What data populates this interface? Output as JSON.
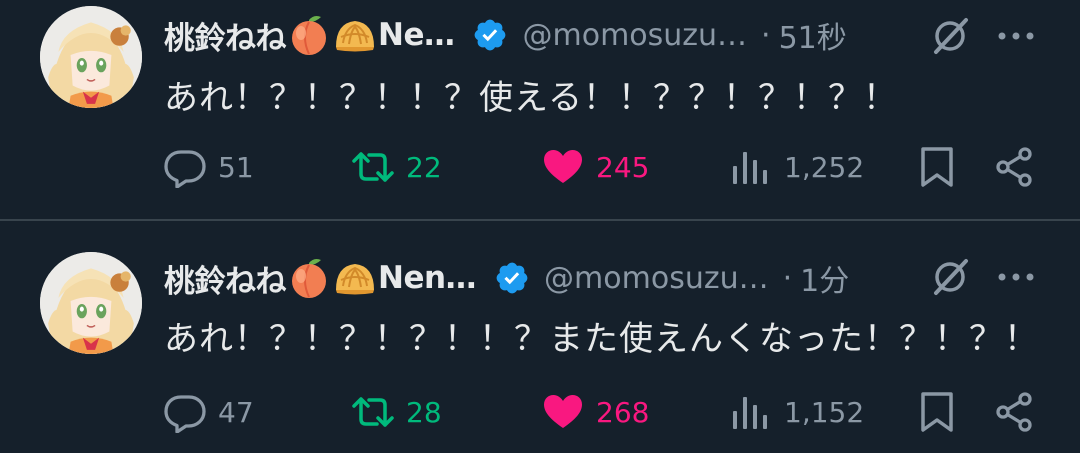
{
  "colors": {
    "background": "#15202b",
    "text": "#e7e9ea",
    "muted": "#8b98a5",
    "retweet": "#00ba7c",
    "like": "#f91880",
    "verified": "#1d9bf0"
  },
  "tweets": [
    {
      "author_name": "桃鈴ねね",
      "author_name_suffix": "Ne…",
      "emojis": [
        "peach-emoji",
        "melon-bread-emoji"
      ],
      "verified": true,
      "handle": "@momosuzu…",
      "separator": "·",
      "time": "51秒",
      "text": "あれ！？！？！！？使える！！？？！？！？！",
      "reply_count": "51",
      "retweet_count": "22",
      "like_count": "245",
      "view_count": "1,252",
      "liked": true
    },
    {
      "author_name": "桃鈴ねね",
      "author_name_suffix": "Nen…",
      "emojis": [
        "peach-emoji",
        "melon-bread-emoji"
      ],
      "verified": true,
      "handle": "@momosuzu…",
      "separator": "·",
      "time": "1分",
      "text": "あれ！？！？！？！！？また使えんくなった！？！？！",
      "reply_count": "47",
      "retweet_count": "28",
      "like_count": "268",
      "view_count": "1,152",
      "liked": true
    }
  ]
}
